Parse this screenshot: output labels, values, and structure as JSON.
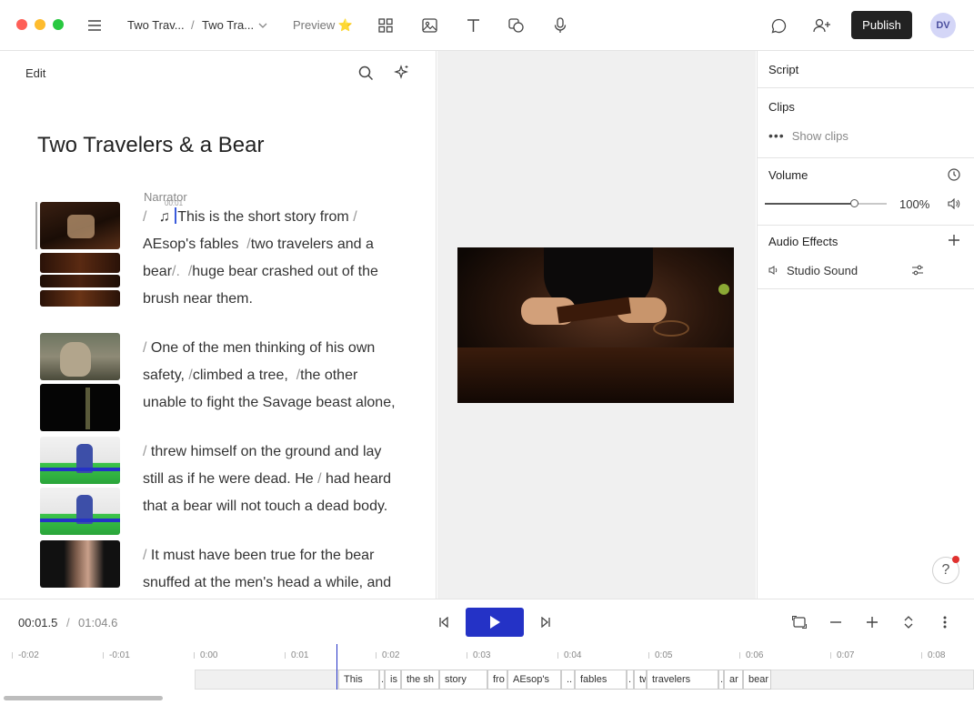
{
  "window": {
    "breadcrumb": [
      "Two Trav...",
      "Two Tra..."
    ],
    "breadcrumb_sep": "/",
    "preview_label": "Preview",
    "preview_badge": "⭐",
    "publish_label": "Publish",
    "avatar_initials": "DV"
  },
  "script_panel": {
    "edit_label": "Edit",
    "title": "Two Travelers & a Bear",
    "speaker": "Narrator",
    "mini_timecode": "00:01",
    "paragraphs": [
      {
        "line1_sep": "/",
        "music": "♫",
        "line1": "This is the short story from",
        "line1_end": "/",
        "line2a": "AEsop's fables",
        "line2_sep": "/",
        "line2b": "two travelers and a",
        "line3a": "bear",
        "line3_sep1": "/.",
        "line3_sep2": "/",
        "line3b": "huge bear crashed out of the",
        "line4": "brush near them."
      },
      {
        "l1_sep": "/",
        "l1": "One of the men thinking of his own",
        "l2a": "safety,",
        "l2_sep": "/",
        "l2b": "climbed a tree,",
        "l2_sep2": "/",
        "l2c": "the other",
        "l3": "unable to fight the Savage beast alone,"
      },
      {
        "l1_sep": "/",
        "l1": "threw himself on the ground and lay",
        "l2a": "still as if he were dead. He",
        "l2_sep": "/",
        "l2b": "had heard",
        "l3": "that a bear will not touch a dead body."
      },
      {
        "l1_sep": "/",
        "l1a": "It must have been",
        "l1b": "true for the bear",
        "l2": "snuffed at the men's head a while, and"
      }
    ]
  },
  "properties": {
    "script_label": "Script",
    "clips_label": "Clips",
    "show_clips": "Show clips",
    "volume_label": "Volume",
    "volume_value": "100%",
    "volume_fraction": 0.74,
    "audio_effects_label": "Audio Effects",
    "studio_sound": "Studio Sound"
  },
  "transport": {
    "current_time": "00:01.5",
    "separator": "/",
    "total_time": "01:04.6"
  },
  "timeline": {
    "ticks": [
      "-0:02",
      "-0:01",
      "0:00",
      "0:01",
      "0:02",
      "0:03",
      "0:04",
      "0:05",
      "0:06",
      "0:07",
      "0:08"
    ],
    "words": [
      "This",
      ".",
      "is",
      "the sh",
      "story",
      "fro",
      "AEsop's",
      "..",
      "fables",
      ".",
      "tw",
      "travelers",
      ".",
      "ar",
      "bear"
    ]
  },
  "colors": {
    "accent": "#2432c6",
    "publish_bg": "#222222",
    "avatar_bg": "#d4d6f7",
    "notification": "#e0312f"
  }
}
